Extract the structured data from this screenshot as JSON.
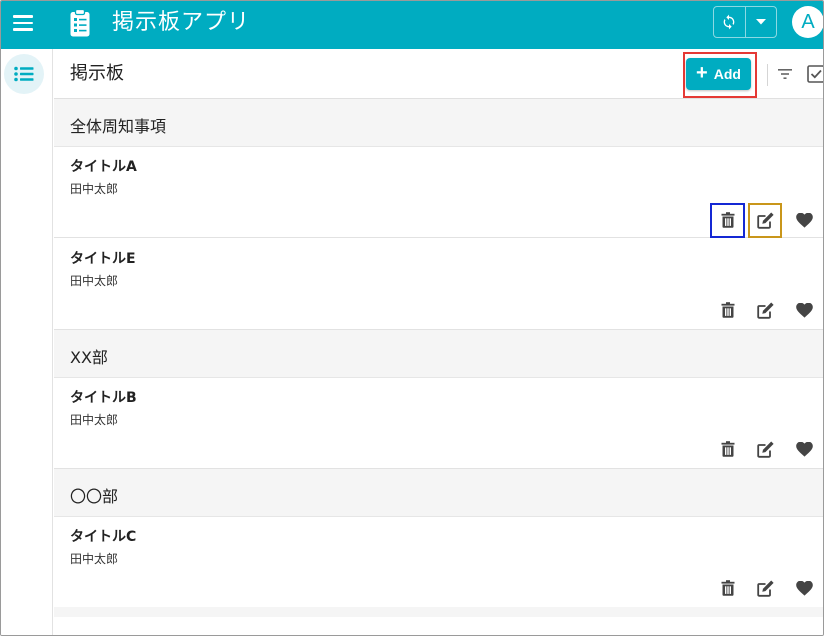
{
  "app": {
    "title": "掲示板アプリ",
    "avatar_initial": "A",
    "accent_color": "#00acc1"
  },
  "toolbar": {
    "page_title": "掲示板",
    "add_label": "Add"
  },
  "sections": [
    {
      "name": "全体周知事項",
      "posts": [
        {
          "title": "タイトルA",
          "author": "田中太郎"
        },
        {
          "title": "タイトルE",
          "author": "田中太郎"
        }
      ]
    },
    {
      "name": "XX部",
      "posts": [
        {
          "title": "タイトルB",
          "author": "田中太郎"
        }
      ]
    },
    {
      "name": "〇〇部",
      "posts": [
        {
          "title": "タイトルC",
          "author": "田中太郎"
        }
      ]
    }
  ],
  "icons": {
    "menu": "menu-icon",
    "app": "clipboard-icon",
    "sync": "sync-icon",
    "dropdown": "chevron-down-icon",
    "rail": "list-icon",
    "filter": "filter-icon",
    "select": "checkbox-icon",
    "delete": "trash-icon",
    "edit": "edit-icon",
    "like": "heart-icon"
  },
  "highlight_colors": {
    "add": "#e53935",
    "delete": "#1428d4",
    "edit": "#c9961a"
  }
}
